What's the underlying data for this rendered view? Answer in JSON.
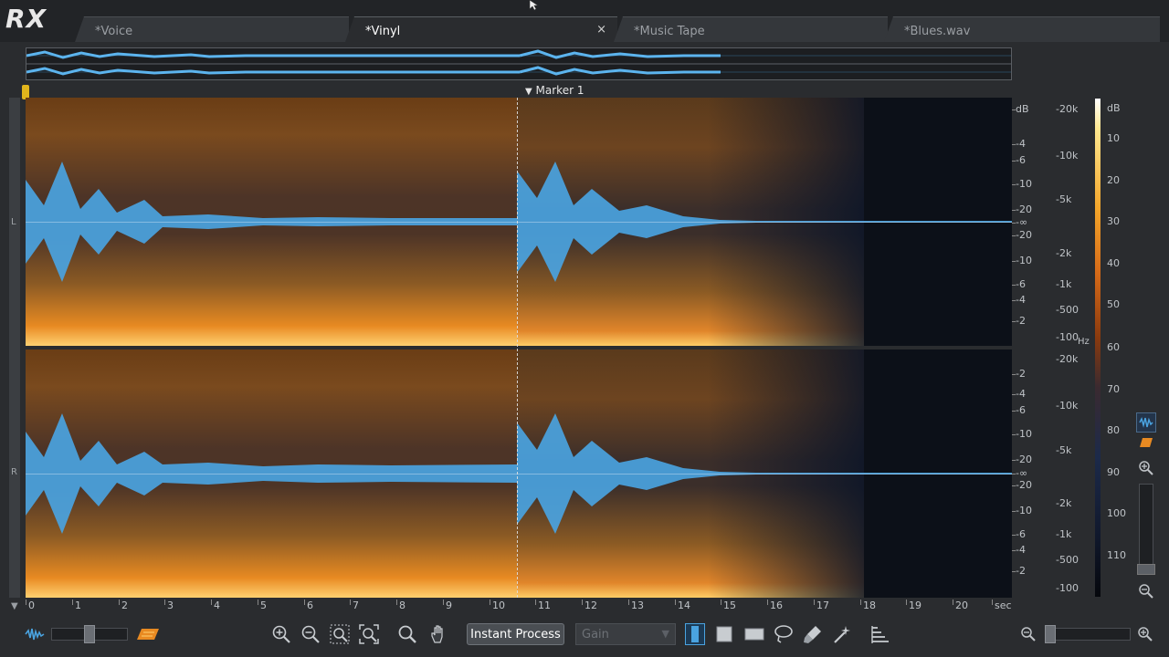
{
  "app": {
    "logo": "RX"
  },
  "tabs": [
    {
      "label": "*Voice",
      "active": false
    },
    {
      "label": "*Vinyl",
      "active": true,
      "close": "×"
    },
    {
      "label": "*Music Tape",
      "active": false
    },
    {
      "label": "*Blues.wav",
      "active": false
    }
  ],
  "marker": {
    "label": "Marker 1"
  },
  "channels": {
    "left": "L",
    "right": "R"
  },
  "amp_scale": {
    "top": [
      "dB",
      "-4",
      "-6",
      "-10",
      "-20",
      "-∞",
      "-20",
      "-10",
      "-6",
      "-4",
      "-2"
    ],
    "bottom": [
      "-2",
      "-4",
      "-6",
      "-10",
      "-20",
      "-∞",
      "-20",
      "-10",
      "-6",
      "-4",
      "-2"
    ]
  },
  "hz_scale": {
    "top": [
      "-20k",
      "-10k",
      "-5k",
      "-2k",
      "-1k",
      "-500",
      "-100"
    ],
    "unit": "Hz",
    "bottom": [
      "-20k",
      "-10k",
      "-5k",
      "-2k",
      "-1k",
      "-500",
      "-100"
    ]
  },
  "colorbar": {
    "labels": [
      "dB",
      "10",
      "20",
      "30",
      "40",
      "50",
      "60",
      "70",
      "80",
      "90",
      "100",
      "110"
    ]
  },
  "time_ruler": {
    "ticks": [
      "0",
      "1",
      "2",
      "3",
      "4",
      "5",
      "6",
      "7",
      "8",
      "9",
      "10",
      "11",
      "12",
      "13",
      "14",
      "15",
      "16",
      "17",
      "18",
      "19",
      "20"
    ],
    "unit": "sec"
  },
  "toolbar": {
    "instant_process": "Instant Process",
    "gain": "Gain"
  },
  "colors": {
    "accent": "#4aa3e0",
    "spectrum_warm": "#e88a22",
    "playhead": "#e2b51c"
  },
  "icons": [
    "waveform-view-icon",
    "spectrogram-view-icon",
    "zoom-in-icon",
    "zoom-out-icon",
    "zoom-selection-icon",
    "zoom-fit-icon",
    "magnify-icon",
    "hand-icon",
    "time-selection-icon",
    "rectangle-selection-icon",
    "frequency-selection-icon",
    "lasso-icon",
    "brush-icon",
    "magic-wand-icon",
    "harmonic-icon"
  ]
}
